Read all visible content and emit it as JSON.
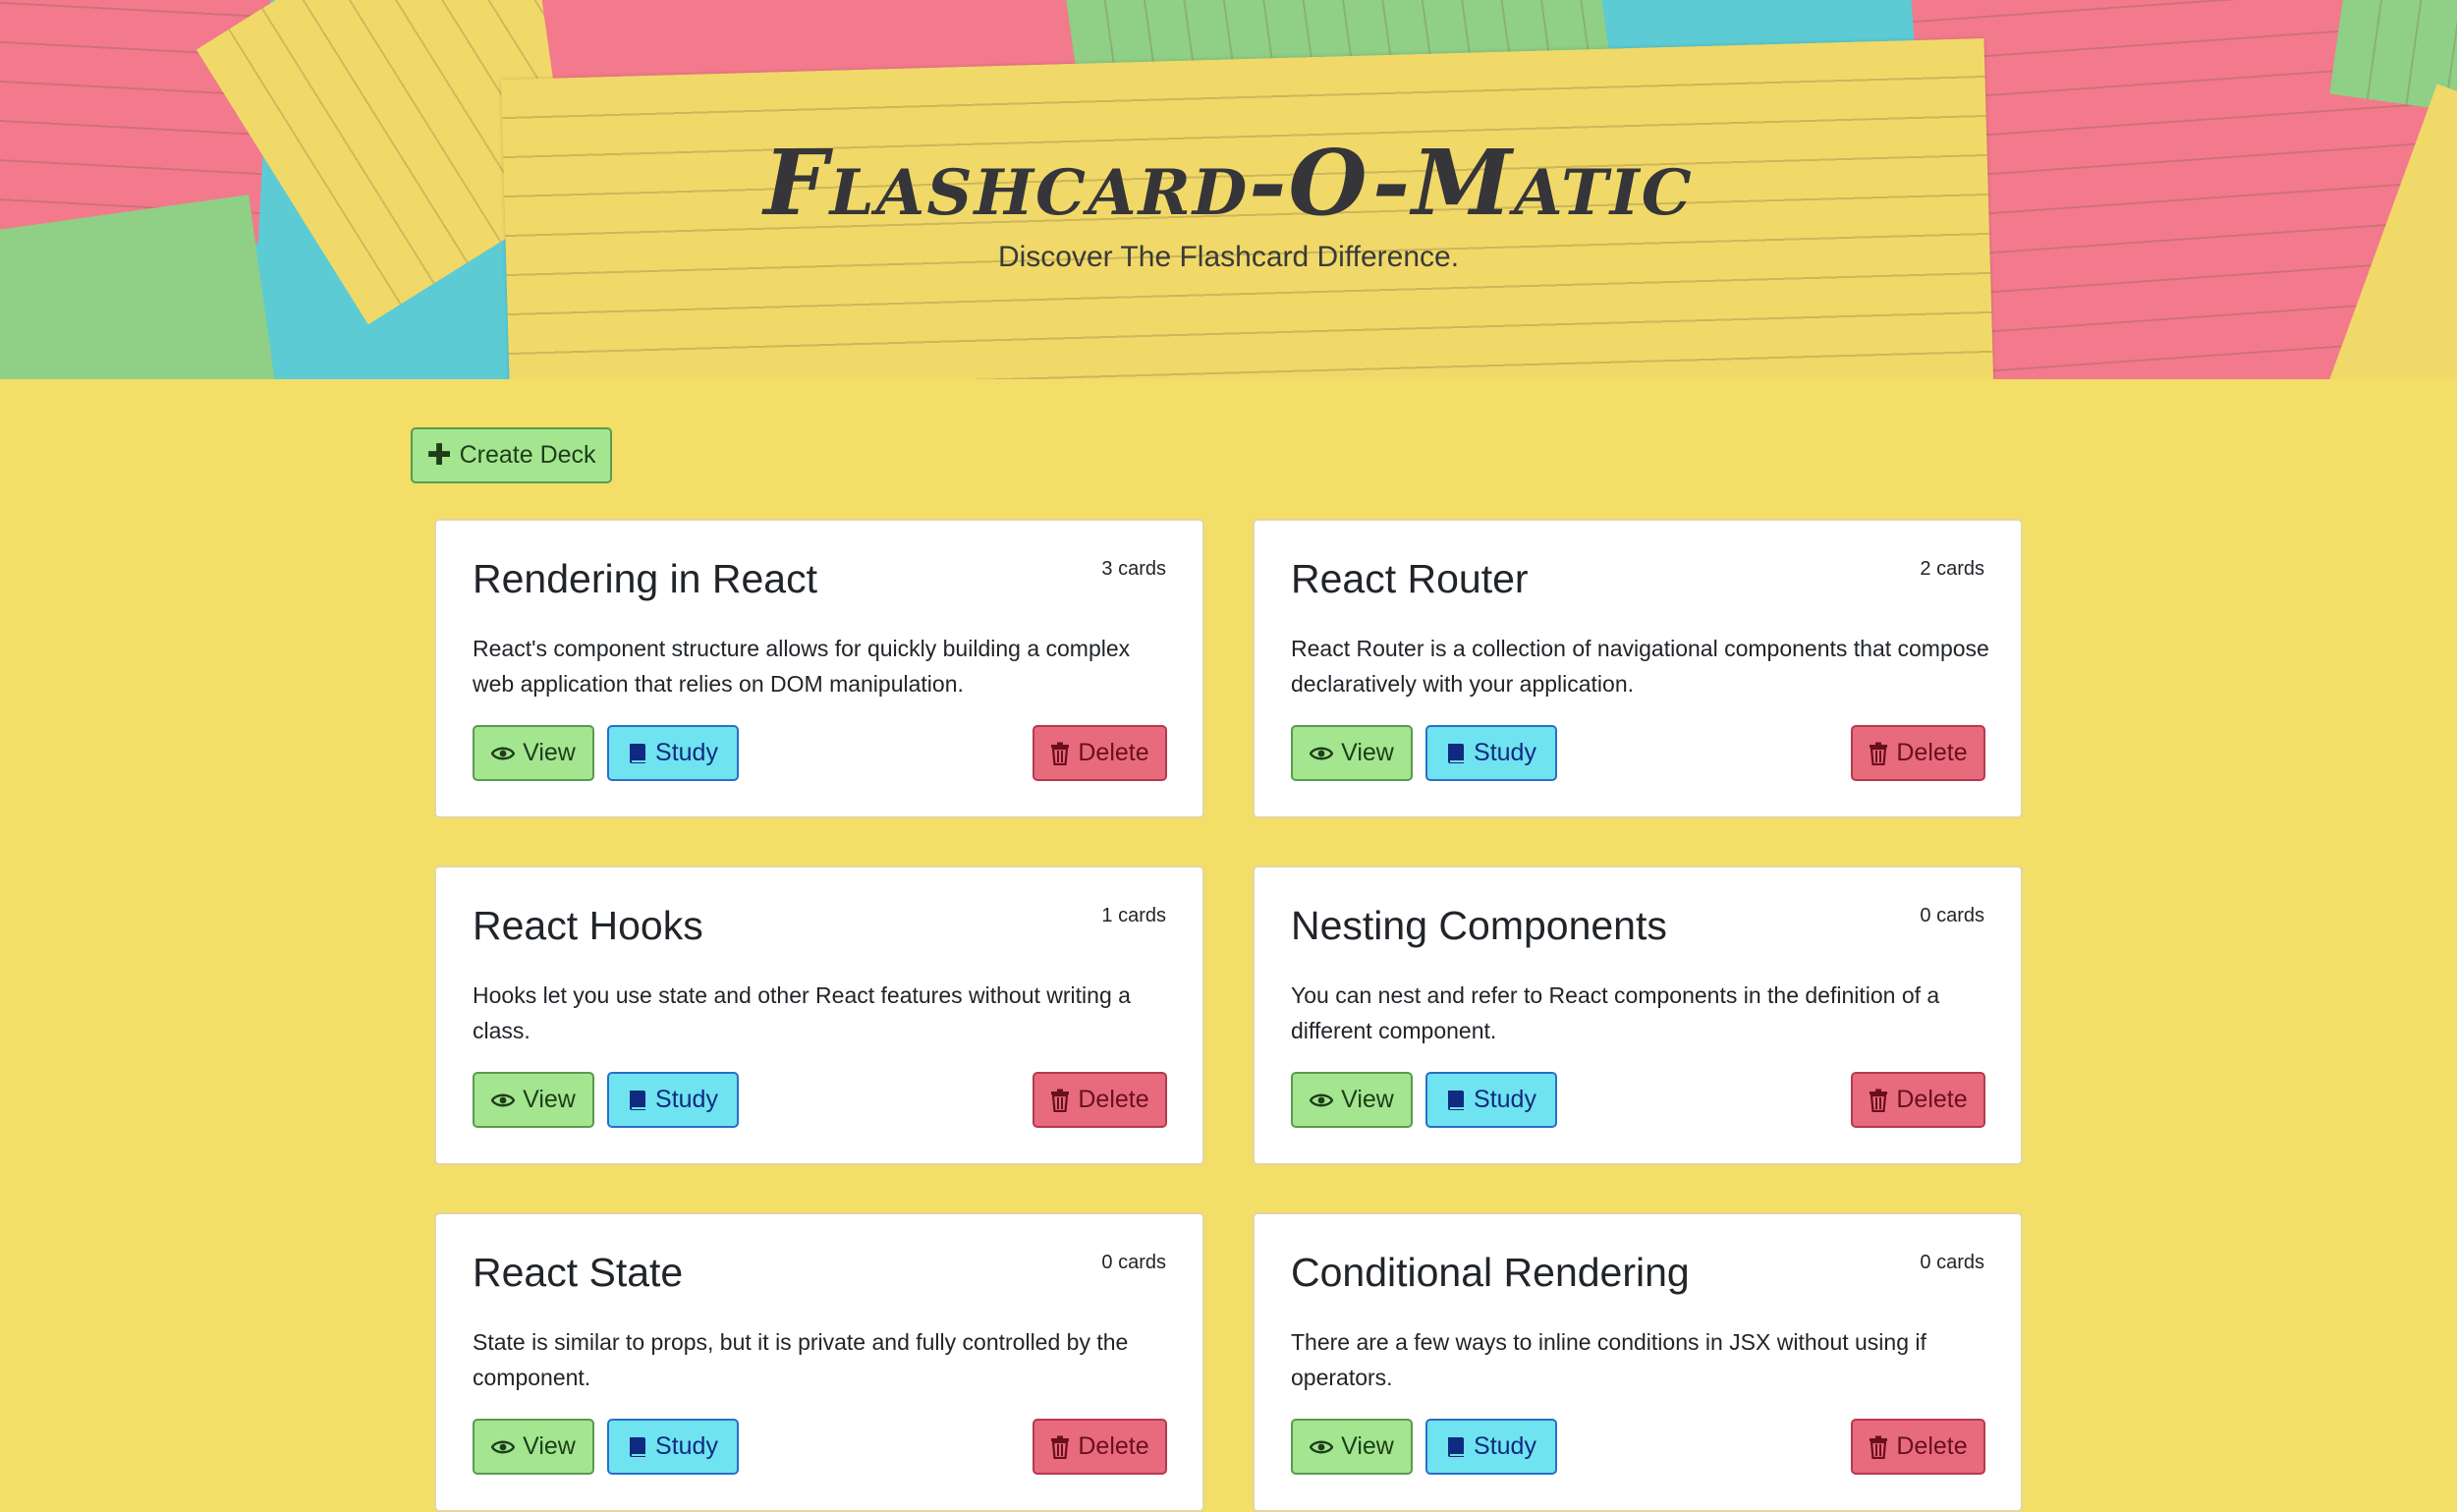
{
  "header": {
    "title": "Flashcard-O-Matic",
    "tagline": "Discover The Flashcard Difference."
  },
  "actions": {
    "create_deck_label": "Create Deck"
  },
  "decks": [
    {
      "name": "Rendering in React",
      "count": "3 cards",
      "description": "React's component structure allows for quickly building a complex web application that relies on DOM manipulation.",
      "view_label": "View",
      "study_label": "Study",
      "delete_label": "Delete"
    },
    {
      "name": "React Router",
      "count": "2 cards",
      "description": "React Router is a collection of navigational components that compose declaratively with your application.",
      "view_label": "View",
      "study_label": "Study",
      "delete_label": "Delete"
    },
    {
      "name": "React Hooks",
      "count": "1 cards",
      "description": "Hooks let you use state and other React features without writing a class.",
      "view_label": "View",
      "study_label": "Study",
      "delete_label": "Delete"
    },
    {
      "name": "Nesting Components",
      "count": "0 cards",
      "description": "You can nest and refer to React components in the definition of a different component.",
      "view_label": "View",
      "study_label": "Study",
      "delete_label": "Delete"
    },
    {
      "name": "React State",
      "count": "0 cards",
      "description": "State is similar to props, but it is private and fully controlled by the component.",
      "view_label": "View",
      "study_label": "Study",
      "delete_label": "Delete"
    },
    {
      "name": "Conditional Rendering",
      "count": "0 cards",
      "description": "There are a few ways to inline conditions in JSX without using if operators.",
      "view_label": "View",
      "study_label": "Study",
      "delete_label": "Delete"
    }
  ],
  "icons": {
    "create": "plus-icon",
    "view": "eye-icon",
    "study": "book-icon",
    "delete": "trash-icon"
  },
  "colors": {
    "page_background": "#f3de68",
    "view_button": "#a3e68f",
    "study_button": "#6fe3ef",
    "delete_button": "#e76b7d"
  }
}
